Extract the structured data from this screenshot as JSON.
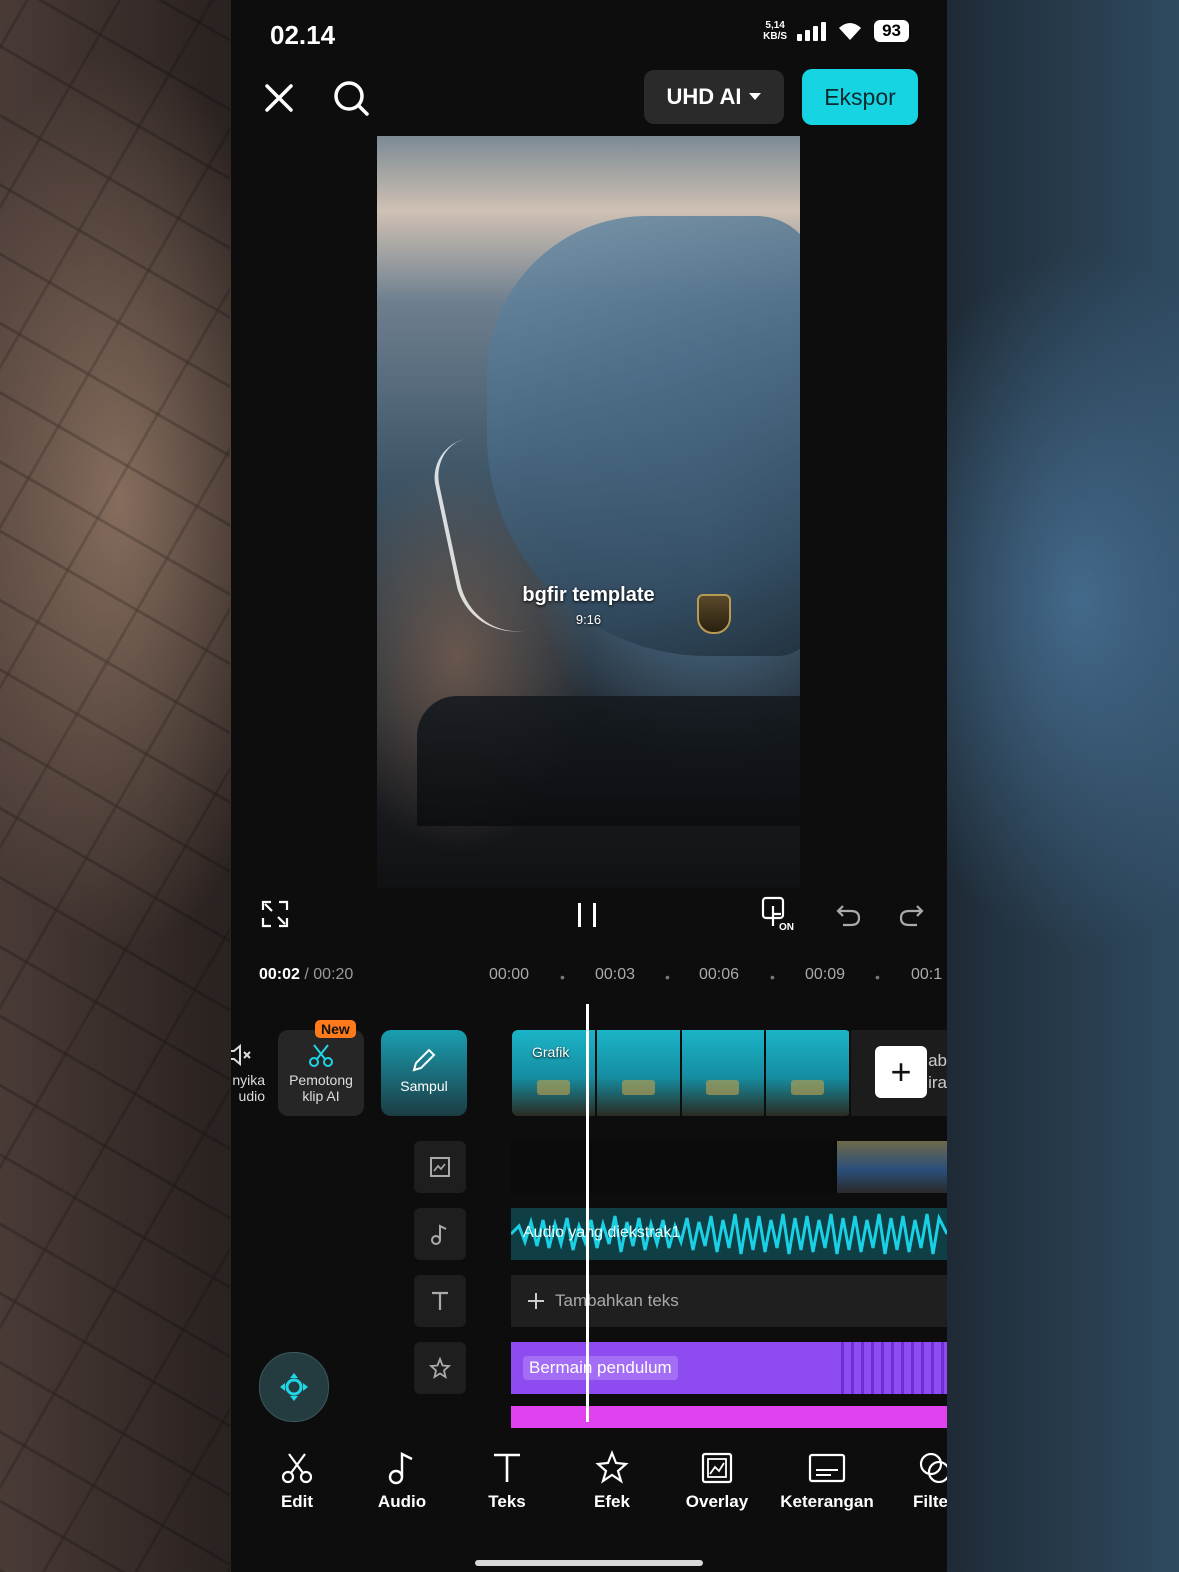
{
  "status_bar": {
    "time": "02.14",
    "net_speed_top": "5,14",
    "net_speed_unit": "KB/S",
    "battery": "93"
  },
  "top_bar": {
    "quality_label": "UHD AI",
    "export_label": "Ekspor"
  },
  "preview": {
    "watermark_title": "bgfir template",
    "watermark_sub": "9:16"
  },
  "timeline": {
    "current_time": "00:02",
    "total_time": "/ 00:20",
    "ticks": [
      "00:00",
      "00:03",
      "00:06",
      "00:09",
      "00:1"
    ]
  },
  "tools": {
    "mute_label_line1": "nyika",
    "mute_label_line2": "udio",
    "new_badge": "New",
    "ai_cutter_line1": "Pemotong",
    "ai_cutter_line2": "klip AI",
    "cover_label": "Sampul",
    "clip_tag": "Grafik",
    "add_clip_peek_1": "ab",
    "add_clip_peek_2": "ira"
  },
  "tracks": {
    "audio_label": "Audio yang diekstrak1",
    "add_text_label": "Tambahkan teks",
    "effect_label": "Bermain pendulum"
  },
  "bottom_nav": [
    "Edit",
    "Audio",
    "Teks",
    "Efek",
    "Overlay",
    "Keterangan",
    "Filte"
  ],
  "colors": {
    "accent": "#17d4e2",
    "audio": "#19d0e4",
    "effect": "#8e4cf0",
    "pink": "#e042f0",
    "badge": "#ff7a1a"
  }
}
